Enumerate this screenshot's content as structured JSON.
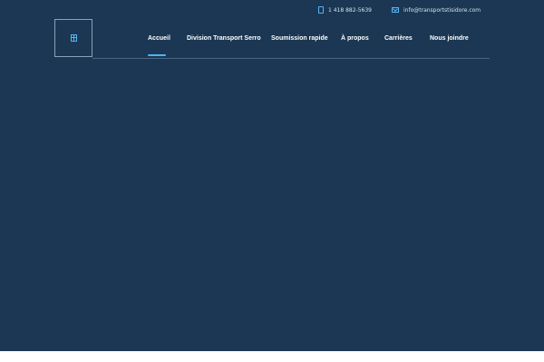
{
  "header": {
    "phone": {
      "icon": "phone-icon",
      "text": "1 418 882-5639"
    },
    "email": {
      "icon": "mail-icon",
      "text": "info@transportstisidore.com"
    },
    "logo": {
      "icon": "logo-icon"
    }
  },
  "nav": {
    "items": [
      {
        "label": "Accueil",
        "active": true
      },
      {
        "label": "Division Transport Serro"
      },
      {
        "label": "Soumission rapide"
      },
      {
        "label": "À propos"
      },
      {
        "label": "Carrières"
      },
      {
        "label": "Nous joindre"
      }
    ]
  },
  "colors": {
    "background": "#1b3753",
    "accent": "#4fb3f6",
    "nav_text": "#ffffff",
    "contact_text": "#d6e2ee"
  }
}
